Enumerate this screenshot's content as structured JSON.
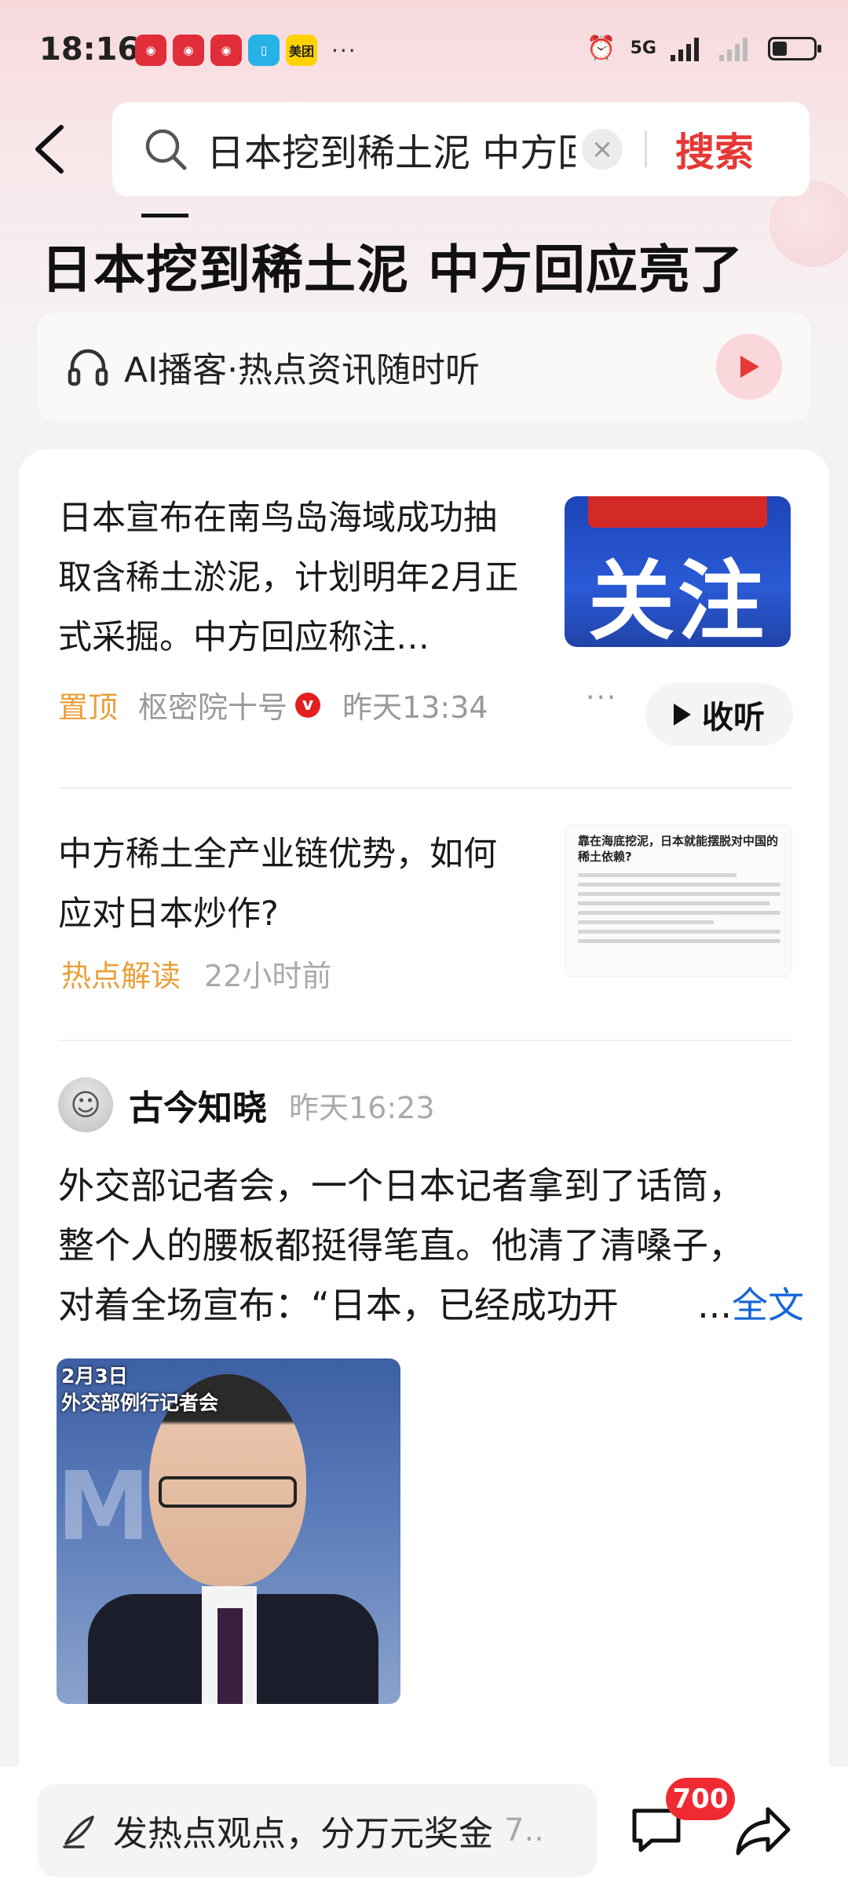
{
  "status_bar": {
    "time": "18:16",
    "app_icons": [
      "pinduoduo-icon",
      "pinduoduo-icon",
      "pinduoduo-icon",
      "book-icon",
      "meituan-icon"
    ],
    "meituan_label": "美团",
    "more": "···",
    "network": "5G",
    "battery_level": 0.35
  },
  "search": {
    "query": "日本挖到稀土泥 中方回应亮了",
    "button": "搜索"
  },
  "headline": "日本挖到稀土泥 中方回应亮了",
  "podcast": {
    "label": "AI播客·热点资讯随时听"
  },
  "items": [
    {
      "text": "日本宣布在南鸟岛海域成功抽取含稀土淤泥，计划明年2月正式采掘。中方回应称注…",
      "tag": "置顶",
      "source": "枢密院十号",
      "time": "昨天13:34",
      "thumb_text": "关注",
      "listen_label": "收听"
    },
    {
      "text": "中方稀土全产业链优势，如何应对日本炒作?",
      "tag": "热点解读",
      "time": "22小时前",
      "thumb_title": "靠在海底挖泥，日本就能摆脱对中国的稀土依赖?"
    }
  ],
  "post": {
    "author": "古今知晓",
    "time": "昨天16:23",
    "line1": "外交部记者会，一个日本记者拿到了话筒，",
    "line2": "整个人的腰板都挺得笔直。他清了清嗓子，",
    "line3": "对着全场宣布：“日本，已经成功开",
    "ellipsis": "...",
    "full_text": "全文",
    "image_caption_line1": "2月3日",
    "image_caption_line2": "外交部例行记者会"
  },
  "bottom": {
    "comment_placeholder": "发热点观点，分万元奖金",
    "comment_suffix": "7..",
    "comment_count": "700"
  }
}
